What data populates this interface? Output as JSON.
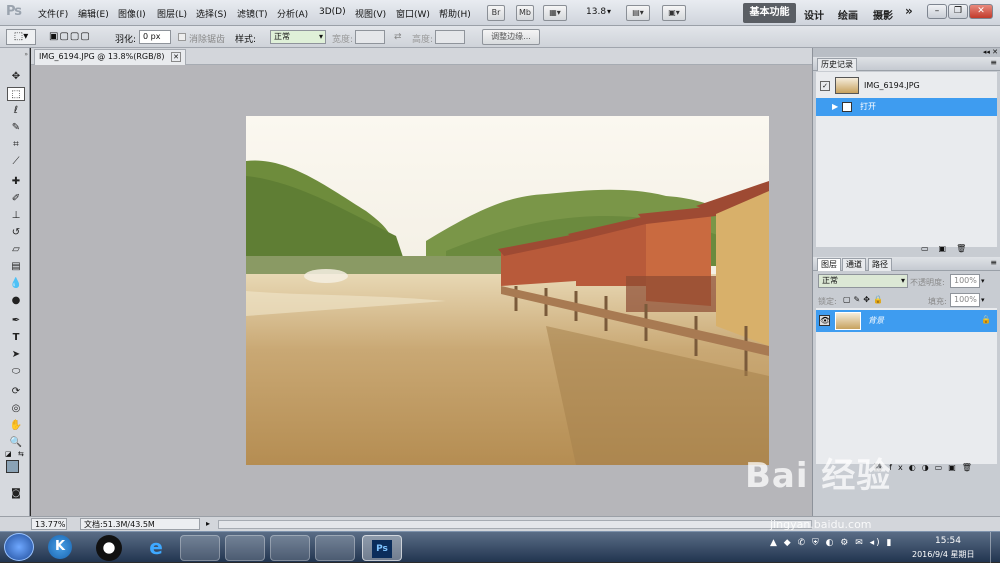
{
  "app": {
    "logo": "Ps"
  },
  "menu": [
    "文件(F)",
    "编辑(E)",
    "图像(I)",
    "图层(L)",
    "选择(S)",
    "滤镜(T)",
    "分析(A)",
    "3D(D)",
    "视图(V)",
    "窗口(W)",
    "帮助(H)"
  ],
  "menubar_buttons": {
    "bridge": "Br",
    "minibridge": "Mb",
    "zoom": "13.8"
  },
  "workspaces": {
    "active": "基本功能",
    "items": [
      "设计",
      "绘画",
      "摄影"
    ],
    "more": "»"
  },
  "options": {
    "feather_label": "羽化:",
    "feather_value": "0 px",
    "antialias_label": "消除锯齿",
    "style_label": "样式:",
    "style_value": "正常",
    "width_label": "宽度:",
    "height_label": "高度:",
    "refine_button": "调整边缘..."
  },
  "document": {
    "tab_title": "IMG_6194.JPG @ 13.8%(RGB/8)"
  },
  "status": {
    "zoom": "13.77%",
    "doc_info": "文档:51.3M/43.5M"
  },
  "history_panel": {
    "title": "历史记录",
    "snapshot": "IMG_6194.JPG",
    "states": [
      "打开"
    ]
  },
  "layers_panel": {
    "tabs": [
      "图层",
      "通道",
      "路径"
    ],
    "blend_mode": "正常",
    "opacity_label": "不透明度:",
    "opacity_value": "100%",
    "lock_label": "锁定:",
    "fill_label": "填充:",
    "fill_value": "100%",
    "layers": [
      {
        "name": "背景"
      }
    ]
  },
  "taskbar": {
    "time": "15:54",
    "date": "2016/9/4 星期日"
  },
  "watermark": {
    "logo": "Bai 经验",
    "url": "jingyan.baidu.com"
  },
  "colors": {
    "accent": "#3e8de0",
    "selected_row": "#3e9cf0"
  }
}
